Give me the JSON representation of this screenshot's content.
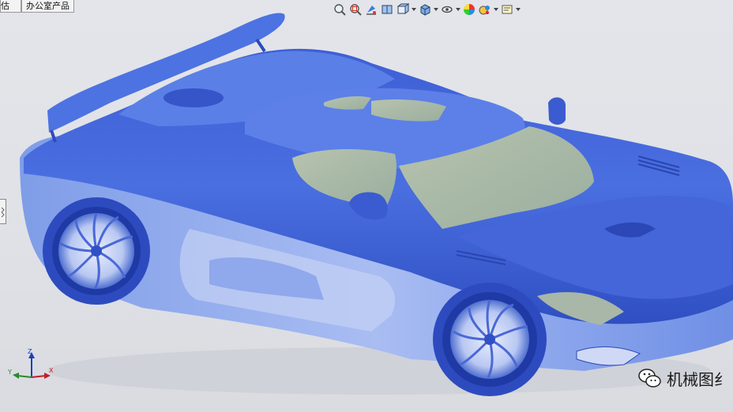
{
  "tabs": [
    {
      "label": "估"
    },
    {
      "label": "办公室产品"
    }
  ],
  "toolbar": {
    "buttons": [
      {
        "icon": "zoom-to-fit-icon"
      },
      {
        "icon": "zoom-to-area-icon"
      },
      {
        "icon": "previous-view-icon"
      },
      {
        "icon": "section-view-icon"
      },
      {
        "icon": "view-orientation-icon",
        "dropdown": true
      },
      {
        "icon": "display-style-icon",
        "dropdown": true
      },
      {
        "icon": "hide-show-items-icon",
        "dropdown": true
      },
      {
        "icon": "edit-appearance-icon"
      },
      {
        "icon": "apply-scene-icon",
        "dropdown": true
      },
      {
        "icon": "view-settings-icon",
        "dropdown": true
      }
    ]
  },
  "triad": {
    "x": "X",
    "y": "Y",
    "z": "Z"
  },
  "watermark": {
    "text": "机械图纟"
  },
  "colors": {
    "body": "#3a62d8",
    "glass": "#a9b8a8",
    "background": "#e0e2e7"
  }
}
